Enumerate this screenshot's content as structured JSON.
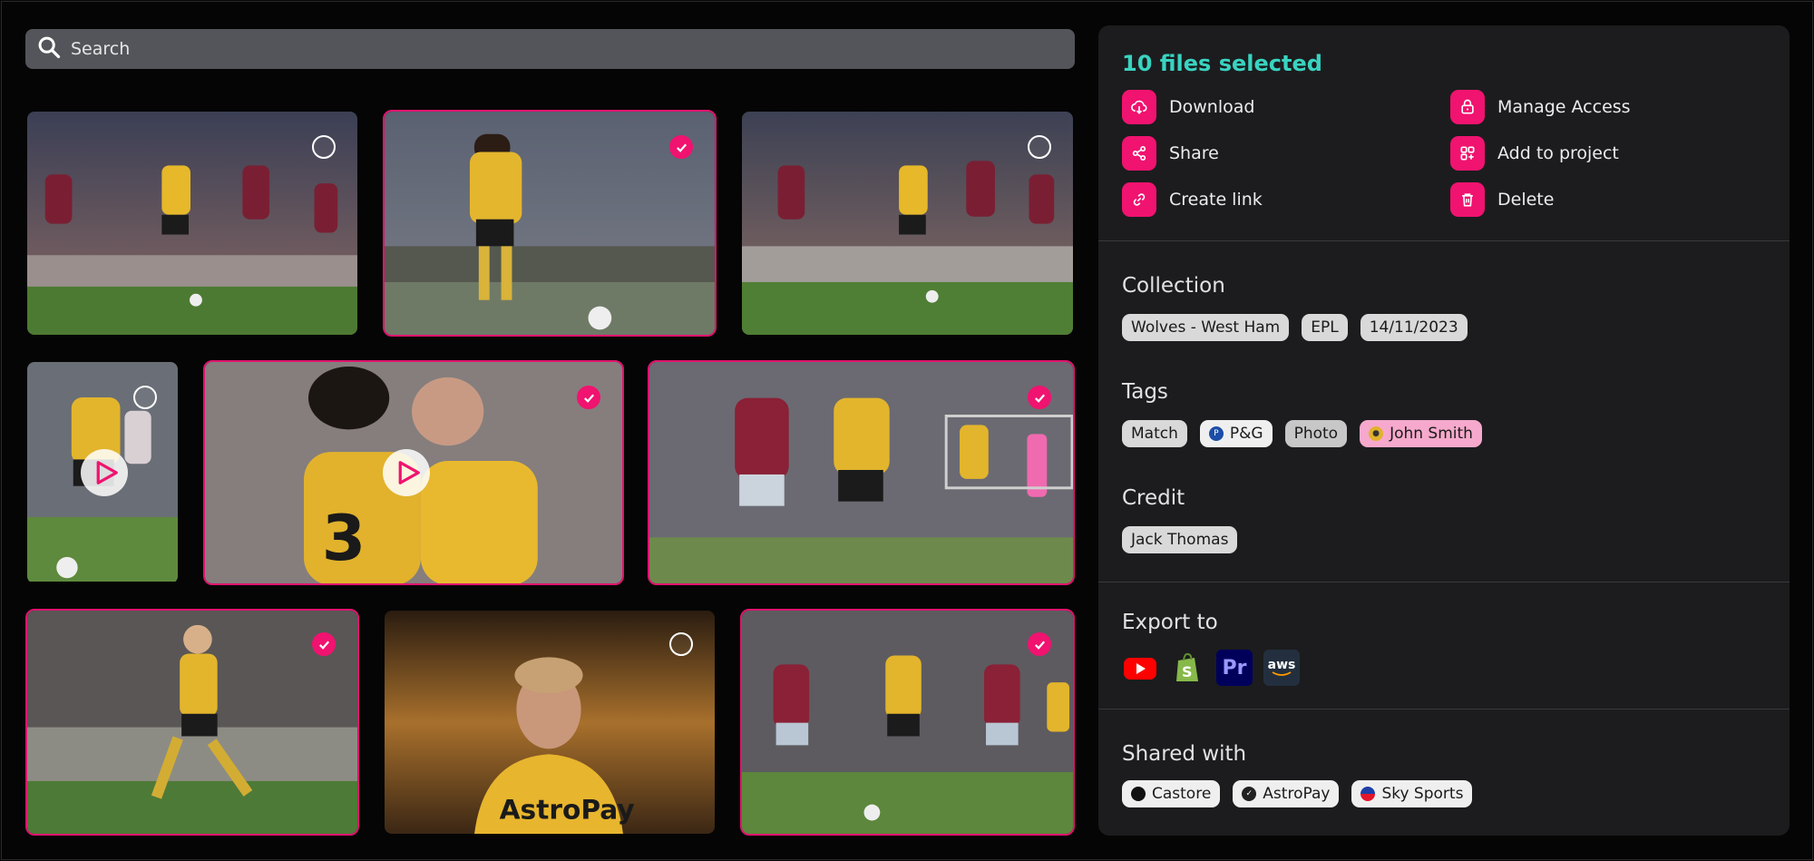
{
  "search": {
    "placeholder": "Search",
    "icon": "search-icon"
  },
  "grid": {
    "tiles": [
      {
        "id": "t1",
        "selected": false,
        "video": false
      },
      {
        "id": "t2",
        "selected": true,
        "video": false
      },
      {
        "id": "t3",
        "selected": false,
        "video": false
      },
      {
        "id": "t4",
        "selected": false,
        "video": true
      },
      {
        "id": "t5",
        "selected": true,
        "video": true
      },
      {
        "id": "t6",
        "selected": true,
        "video": false
      },
      {
        "id": "t7",
        "selected": true,
        "video": false
      },
      {
        "id": "t8",
        "selected": false,
        "video": false
      },
      {
        "id": "t9",
        "selected": true,
        "video": false
      }
    ]
  },
  "panel": {
    "selection_title": "10 files selected",
    "actions": {
      "download": "Download",
      "manage_access": "Manage Access",
      "share": "Share",
      "add_to_project": "Add to project",
      "create_link": "Create link",
      "delete": "Delete"
    },
    "collection": {
      "title": "Collection",
      "chips": [
        "Wolves - West Ham",
        "EPL",
        "14/11/2023"
      ]
    },
    "tags": {
      "title": "Tags",
      "chips": [
        "Match",
        "P&G",
        "Photo",
        "John Smith"
      ]
    },
    "credit": {
      "title": "Credit",
      "chips": [
        "Jack Thomas"
      ]
    },
    "export": {
      "title": "Export to",
      "targets": [
        "youtube-icon",
        "shopify-icon",
        "premiere-pro-icon",
        "aws-icon"
      ],
      "premiere_label": "Pr",
      "aws_label": "aws"
    },
    "shared": {
      "title": "Shared with",
      "chips": [
        "Castore",
        "AstroPay",
        "Sky Sports"
      ]
    }
  },
  "colors": {
    "accent": "#f0136f",
    "selection_text": "#39d3c0",
    "panel_bg": "#1c1c1e"
  }
}
